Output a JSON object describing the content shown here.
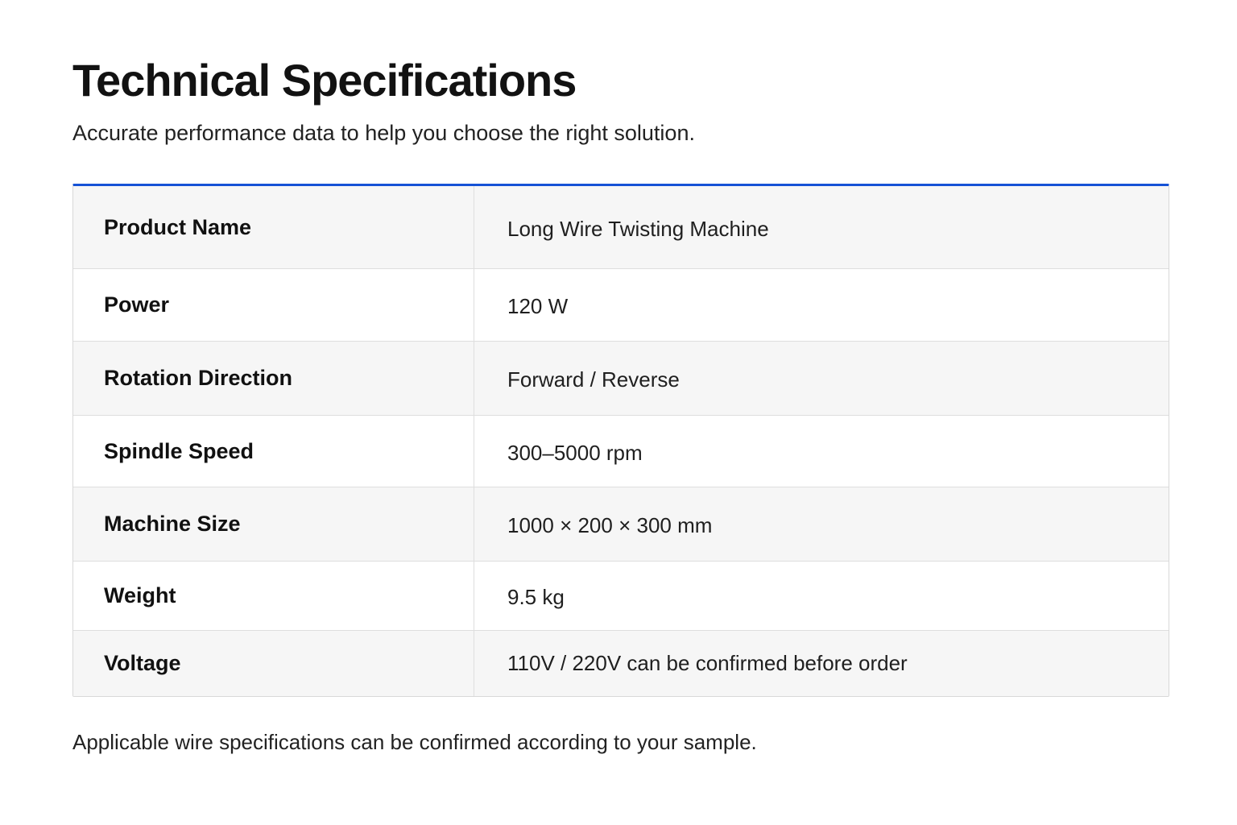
{
  "header": {
    "title": "Technical Specifications",
    "subtitle": "Accurate performance data to help you choose the right solution."
  },
  "colors": {
    "accent": "#1552d6",
    "row_shade": "#f6f6f6",
    "border": "#dedede"
  },
  "specs": [
    {
      "label": "Product Name",
      "value": "Long Wire Twisting Machine"
    },
    {
      "label": "Power",
      "value": "120 W"
    },
    {
      "label": "Rotation Direction",
      "value": "Forward / Reverse"
    },
    {
      "label": "Spindle Speed",
      "value": "300–5000 rpm"
    },
    {
      "label": "Machine Size",
      "value": "1000 × 200 × 300 mm"
    },
    {
      "label": "Weight",
      "value": "9.5 kg"
    },
    {
      "label": "Voltage",
      "value": "110V / 220V can be confirmed before order"
    }
  ],
  "footer": {
    "note": "Applicable wire specifications can be confirmed according to your sample."
  }
}
